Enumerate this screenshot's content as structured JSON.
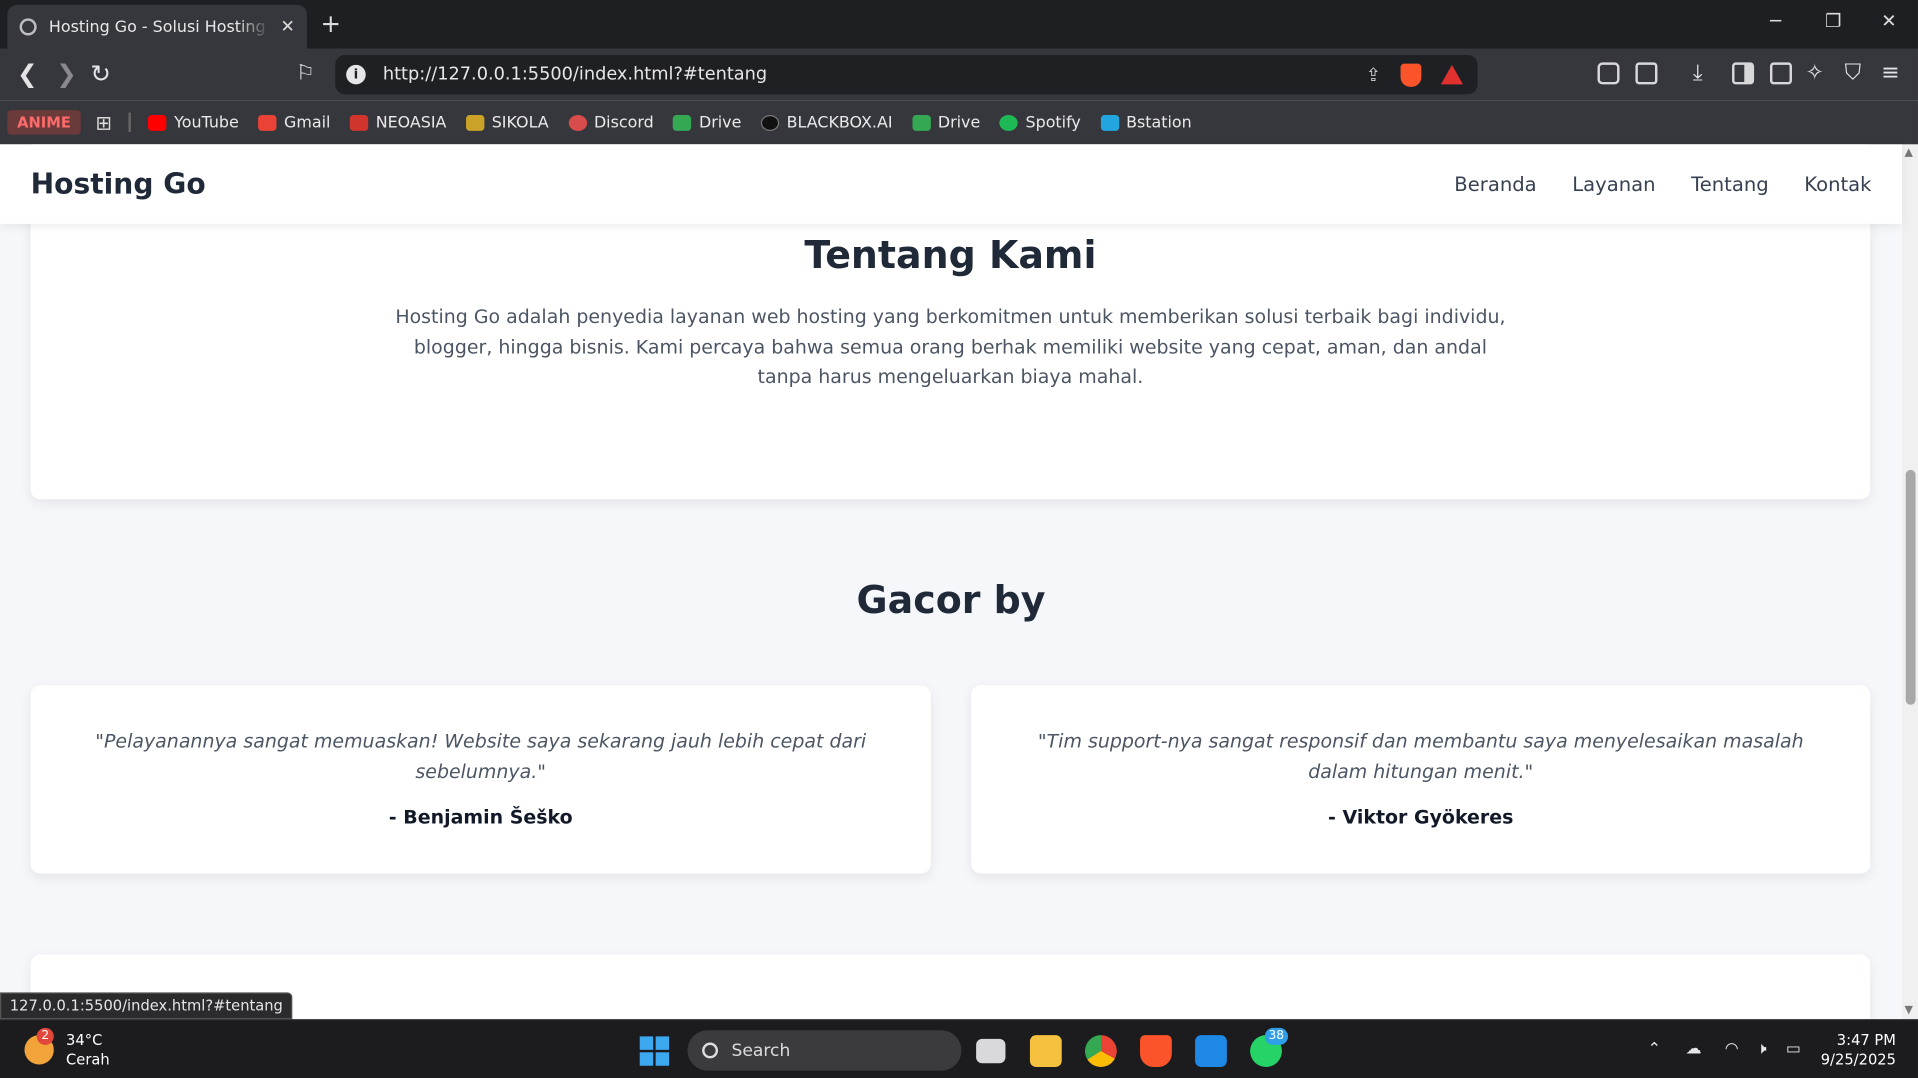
{
  "browser": {
    "tab_title": "Hosting Go - Solusi Hosting Cepat",
    "new_tab": "+",
    "url": "http://127.0.0.1:5500/index.html?#tentang",
    "status_url": "127.0.0.1:5500/index.html?#tentang",
    "bookmarks": [
      {
        "label": "YouTube",
        "color": "#ff0000"
      },
      {
        "label": "Gmail",
        "color": "#ea4335"
      },
      {
        "label": "NEOASIA",
        "color": "#d0342c"
      },
      {
        "label": "SIKOLA",
        "color": "#c9a227"
      },
      {
        "label": "Discord",
        "color": "#d94c4c"
      },
      {
        "label": "Drive",
        "color": "#34a853"
      },
      {
        "label": "BLACKBOX.AI",
        "color": "#111111"
      },
      {
        "label": "Drive",
        "color": "#34a853"
      },
      {
        "label": "Spotify",
        "color": "#1db954"
      },
      {
        "label": "Bstation",
        "color": "#23a5e0"
      }
    ],
    "anime_label": "ANIME"
  },
  "site": {
    "brand": "Hosting Go",
    "nav": [
      "Beranda",
      "Layanan",
      "Tentang",
      "Kontak"
    ],
    "about": {
      "title": "Tentang Kami",
      "text": "Hosting Go adalah penyedia layanan web hosting yang berkomitmen untuk memberikan solusi terbaik bagi individu, blogger, hingga bisnis. Kami percaya bahwa semua orang berhak memiliki website yang cepat, aman, dan andal tanpa harus mengeluarkan biaya mahal."
    },
    "testimonials_title": "Gacor by",
    "testimonials": [
      {
        "quote": "\"Pelayanannya sangat memuaskan! Website saya sekarang jauh lebih cepat dari sebelumnya.\"",
        "author": "- Benjamin Šeško"
      },
      {
        "quote": "\"Tim support-nya sangat responsif dan membantu saya menyelesaikan masalah dalam hitungan menit.\"",
        "author": "- Viktor Gyökeres"
      }
    ]
  },
  "taskbar": {
    "weather_temp": "34°C",
    "weather_desc": "Cerah",
    "weather_badge": "2",
    "search_label": "Search",
    "whatsapp_badge": "38",
    "time": "3:47 PM",
    "date": "9/25/2025"
  }
}
